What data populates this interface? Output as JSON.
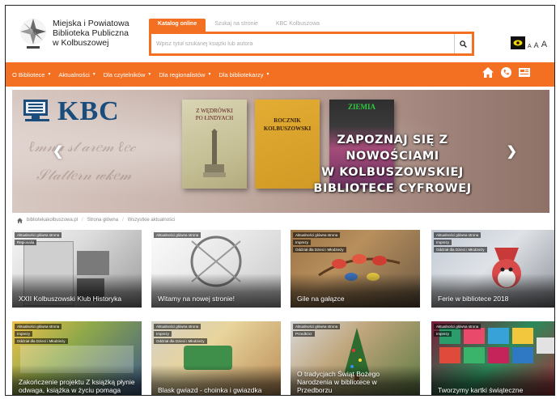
{
  "header": {
    "library_name": [
      "Miejska i Powiatowa",
      "Biblioteka Publiczna",
      "w Kolbuszowej"
    ],
    "tabs": [
      {
        "label": "Katalog online"
      },
      {
        "label": "Szukaj na stronie"
      },
      {
        "label": "KBC Kolbuszowa"
      }
    ],
    "search_placeholder": "Wpisz tytuł szukanej książki lub autora",
    "font_sizes": [
      "A",
      "A",
      "A"
    ]
  },
  "nav": {
    "items": [
      {
        "label": "O Bibliotece"
      },
      {
        "label": "Aktualności"
      },
      {
        "label": "Dla czytelników"
      },
      {
        "label": "Dla regionalistów"
      },
      {
        "label": "Dla bibliotekarzy"
      }
    ]
  },
  "banner": {
    "logo_text": "KBC",
    "headline": [
      "ZAPOZNAJ SIĘ Z NOWOŚCIAMI",
      "W KOLBUSZOWSKIEJ",
      "BIBLIOTECE CYFROWEJ"
    ],
    "book1_title": [
      "Z WĘDRÓWKI",
      "PO ŁINDYACH"
    ],
    "book2_title": [
      "ROCZNIK",
      "KOLBUSZOWSKI"
    ],
    "book3_title": "ZIEMIA"
  },
  "breadcrumb": [
    "bibliotekakolbuszowa.pl",
    "Strona główna",
    "Wszystkie aktualności"
  ],
  "cards": [
    {
      "title": "XXII Kolbuszowski Klub Historyka",
      "tags": [
        "Aktualności główna strona",
        "Regionalia"
      ]
    },
    {
      "title": "Witamy na nowej stronie!",
      "tags": [
        "Aktualności główna strona"
      ]
    },
    {
      "title": "Gile na gałązce",
      "tags": [
        "Aktualności główna strona",
        "Imprezy",
        "Oddział dla Dzieci i Młodzieży"
      ]
    },
    {
      "title": "Ferie w bibliotece 2018",
      "tags": [
        "Aktualności główna strona",
        "Imprezy",
        "Oddział dla Dzieci i Młodzieży"
      ]
    },
    {
      "title": "Zakończenie projektu Z książką płynie odwaga, książka w życiu pomaga",
      "tags": [
        "Aktualności główna strona",
        "Imprezy",
        "Oddział dla Dzieci i Młodzieży"
      ]
    },
    {
      "title": "Blask gwiazd - choinka i gwiazdka",
      "tags": [
        "Aktualności główna strona",
        "Imprezy",
        "Oddział dla Dzieci i Młodzieży"
      ]
    },
    {
      "title": "O tradycjach Świąt Bożego Narodzenia w bibliotece w Przedborzu",
      "tags": [
        "Aktualności główna strona",
        "Przedbórz"
      ]
    },
    {
      "title": "Tworzymy kartki świąteczne",
      "tags": [
        "Aktualności główna strona",
        "Imprezy"
      ]
    }
  ],
  "colors": {
    "accent": "#f36f21",
    "kbc_blue": "#1b4d7c"
  }
}
